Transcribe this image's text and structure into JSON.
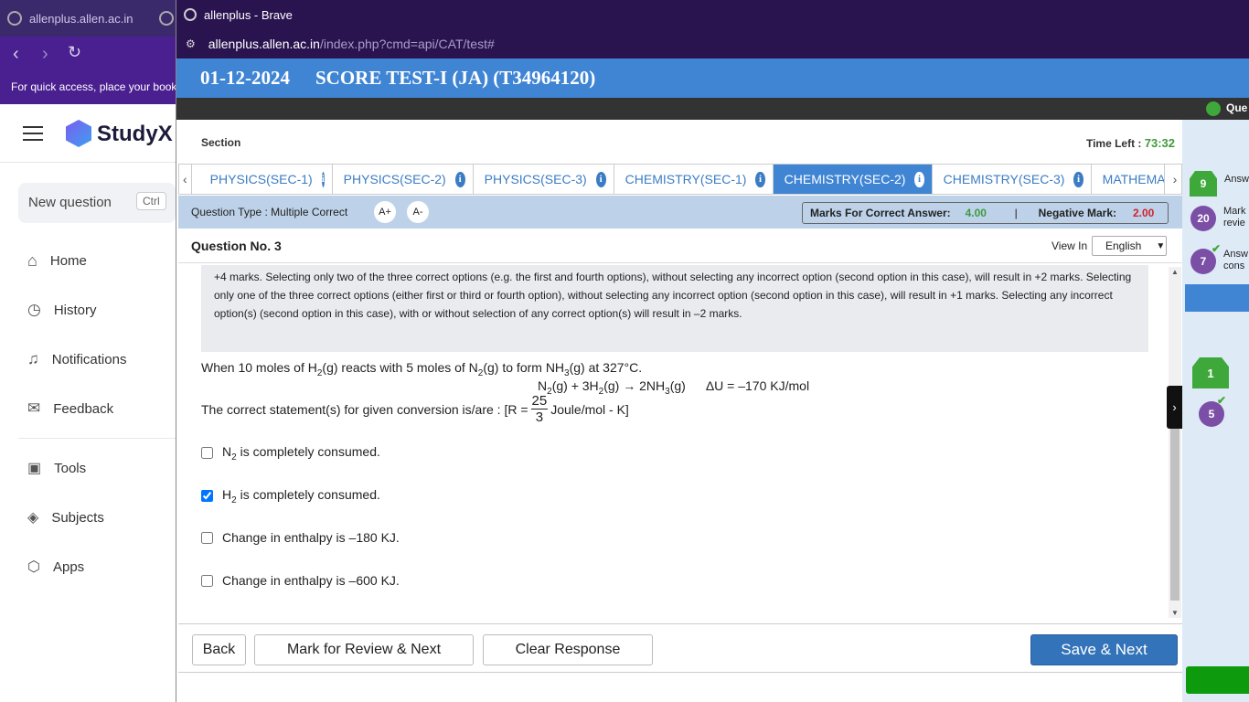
{
  "background": {
    "tab_title": "allenplus.allen.ac.in",
    "bookmarks_hint": "For quick access, place your bookm",
    "studyx": {
      "logo": "StudyX",
      "new_question": "New question",
      "shortcut": "Ctrl",
      "menu": [
        "Home",
        "History",
        "Notifications",
        "Feedback",
        "Tools",
        "Subjects",
        "Apps"
      ]
    }
  },
  "popup": {
    "window_title": "allenplus - Brave",
    "url_host": "allenplus.allen.ac.in",
    "url_path": "/index.php?cmd=api/CAT/test#",
    "test_date": "01-12-2024",
    "test_name": "SCORE TEST-I (JA) (T34964120)",
    "que_label": "Que",
    "section_label": "Section",
    "time_left_label": "Time Left :",
    "time_left_value": "73:32",
    "tabs": [
      "PHYSICS(SEC-1)",
      "PHYSICS(SEC-2)",
      "PHYSICS(SEC-3)",
      "CHEMISTRY(SEC-1)",
      "CHEMISTRY(SEC-2)",
      "CHEMISTRY(SEC-3)",
      "MATHEMATI"
    ],
    "active_tab": "CHEMISTRY(SEC-2)",
    "question_type": "Question Type : Multiple Correct",
    "font_up": "A+",
    "font_down": "A-",
    "marks_correct_label": "Marks For Correct Answer:",
    "marks_correct_value": "4.00",
    "separator": "|",
    "negative_label": "Negative Mark:",
    "negative_value": "2.00",
    "question_no": "Question No. 3",
    "view_in_label": "View In",
    "language": "English",
    "instructions": "+4 marks. Selecting only two of the three correct options (e.g. the first and fourth options), without selecting any incorrect option (second option in this case), will result in +2 marks. Selecting only one of the three correct options (either first or third or fourth option), without selecting any incorrect option (second option in this case), will result in +1 marks. Selecting any incorrect option(s) (second option in this case), with or without selection of any correct option(s) will result in –2 marks.",
    "question": {
      "line1_a": "When 10 moles of H",
      "line1_b": "(g) reacts with 5 moles of N",
      "line1_c": "(g) to form NH",
      "line1_d": "(g) at 327°C.",
      "sub2": "2",
      "sub3": "3",
      "eq_a": "N",
      "eq_b": "(g) + 3H",
      "eq_c": "(g) → 2NH",
      "eq_d": "(g)",
      "eq_du": "ΔU = –170 KJ/mol",
      "stmt_a": "The correct statement(s) for given conversion is/are : [R =",
      "frac_num": "25",
      "frac_den": "3",
      "stmt_b": "Joule/mol - K]"
    },
    "options": [
      {
        "pre": "N",
        "sub": "2",
        "post": " is completely consumed.",
        "checked": false
      },
      {
        "pre": "H",
        "sub": "2",
        "post": " is completely consumed.",
        "checked": true
      },
      {
        "pre": "Change in enthalpy is –180 KJ.",
        "sub": "",
        "post": "",
        "checked": false
      },
      {
        "pre": "Change in enthalpy is –600 KJ.",
        "sub": "",
        "post": "",
        "checked": false
      }
    ],
    "buttons": {
      "back": "Back",
      "mark_review": "Mark for Review & Next",
      "clear": "Clear Response",
      "save_next": "Save & Next"
    },
    "legend": [
      {
        "count": "9",
        "label_a": "Answ",
        "label_b": ""
      },
      {
        "count": "20",
        "label_a": "Mark",
        "label_b": "revie"
      },
      {
        "count": "7",
        "label_a": "Answ",
        "label_b": "cons"
      }
    ],
    "palette": [
      "1",
      "5"
    ],
    "colors": {
      "accent": "#3f85d4",
      "answered": "#3fa83a",
      "review": "#7b4fa6",
      "time": "#3f9a3a",
      "negative": "#d0232a"
    }
  }
}
